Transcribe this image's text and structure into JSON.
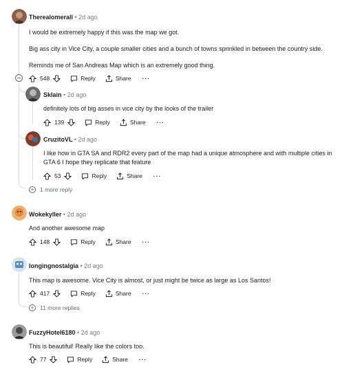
{
  "comments": [
    {
      "username": "Therealomerall",
      "time": "2d ago",
      "lines": [
        "I would be extremely happy if this was the map we got.",
        "Big ass city in Vice City, a couple smaller cities and a bunch of towns sprinkled in between the country side.",
        "Reminds me of San Andreas Map which is an extremely good thing."
      ],
      "votes": "548",
      "reply_label": "Reply",
      "share_label": "Share",
      "more_label": "···",
      "avatar_color": "#8b5e4a"
    },
    {
      "username": "Sklain",
      "time": "2d ago",
      "lines": [
        "definitely lots of big asses in vice city by the looks of the trailer"
      ],
      "votes": "139",
      "reply_label": "Reply",
      "share_label": "Share",
      "more_label": "···",
      "avatar_color": "#6a6a6a"
    },
    {
      "username": "CruzitoVL",
      "time": "2d ago",
      "lines": [
        "I like how in GTA SA and RDR2 every part of the map had a unique atmosphere and with multiple cities in",
        "GTA 6 I hope they replicate that feature"
      ],
      "votes": "53",
      "reply_label": "Reply",
      "share_label": "Share",
      "more_label": "···",
      "avatar_color": "#7a3d2e"
    },
    {
      "username": "Wokekyller",
      "time": "2d ago",
      "lines": [
        "And another awesome map"
      ],
      "votes": "148",
      "reply_label": "Reply",
      "share_label": "Share",
      "more_label": "···",
      "avatar_color": "#e8a060"
    },
    {
      "username": "longingnostalgia",
      "time": "2d ago",
      "lines": [
        "This map is awesome. Vice City is almost, or just might be twice as large as Los Santos!"
      ],
      "votes": "417",
      "reply_label": "Reply",
      "share_label": "Share",
      "more_label": "···",
      "avatar_color": "#5a8fb8"
    },
    {
      "username": "FuzzyHotel6180",
      "time": "2d ago",
      "lines": [
        "This is beautiful! Really like the colors too."
      ],
      "votes": "77",
      "reply_label": "Reply",
      "share_label": "Share",
      "more_label": "···",
      "avatar_color": "#4a4a4a"
    }
  ],
  "more_replies": [
    {
      "label": "1 more reply"
    },
    {
      "label": "11 more replies"
    }
  ],
  "separator": "•",
  "colors": {
    "text": "#1c1c1c",
    "meta": "#7c7c7c",
    "link": "#576f76",
    "thread": "#d8dadc"
  }
}
